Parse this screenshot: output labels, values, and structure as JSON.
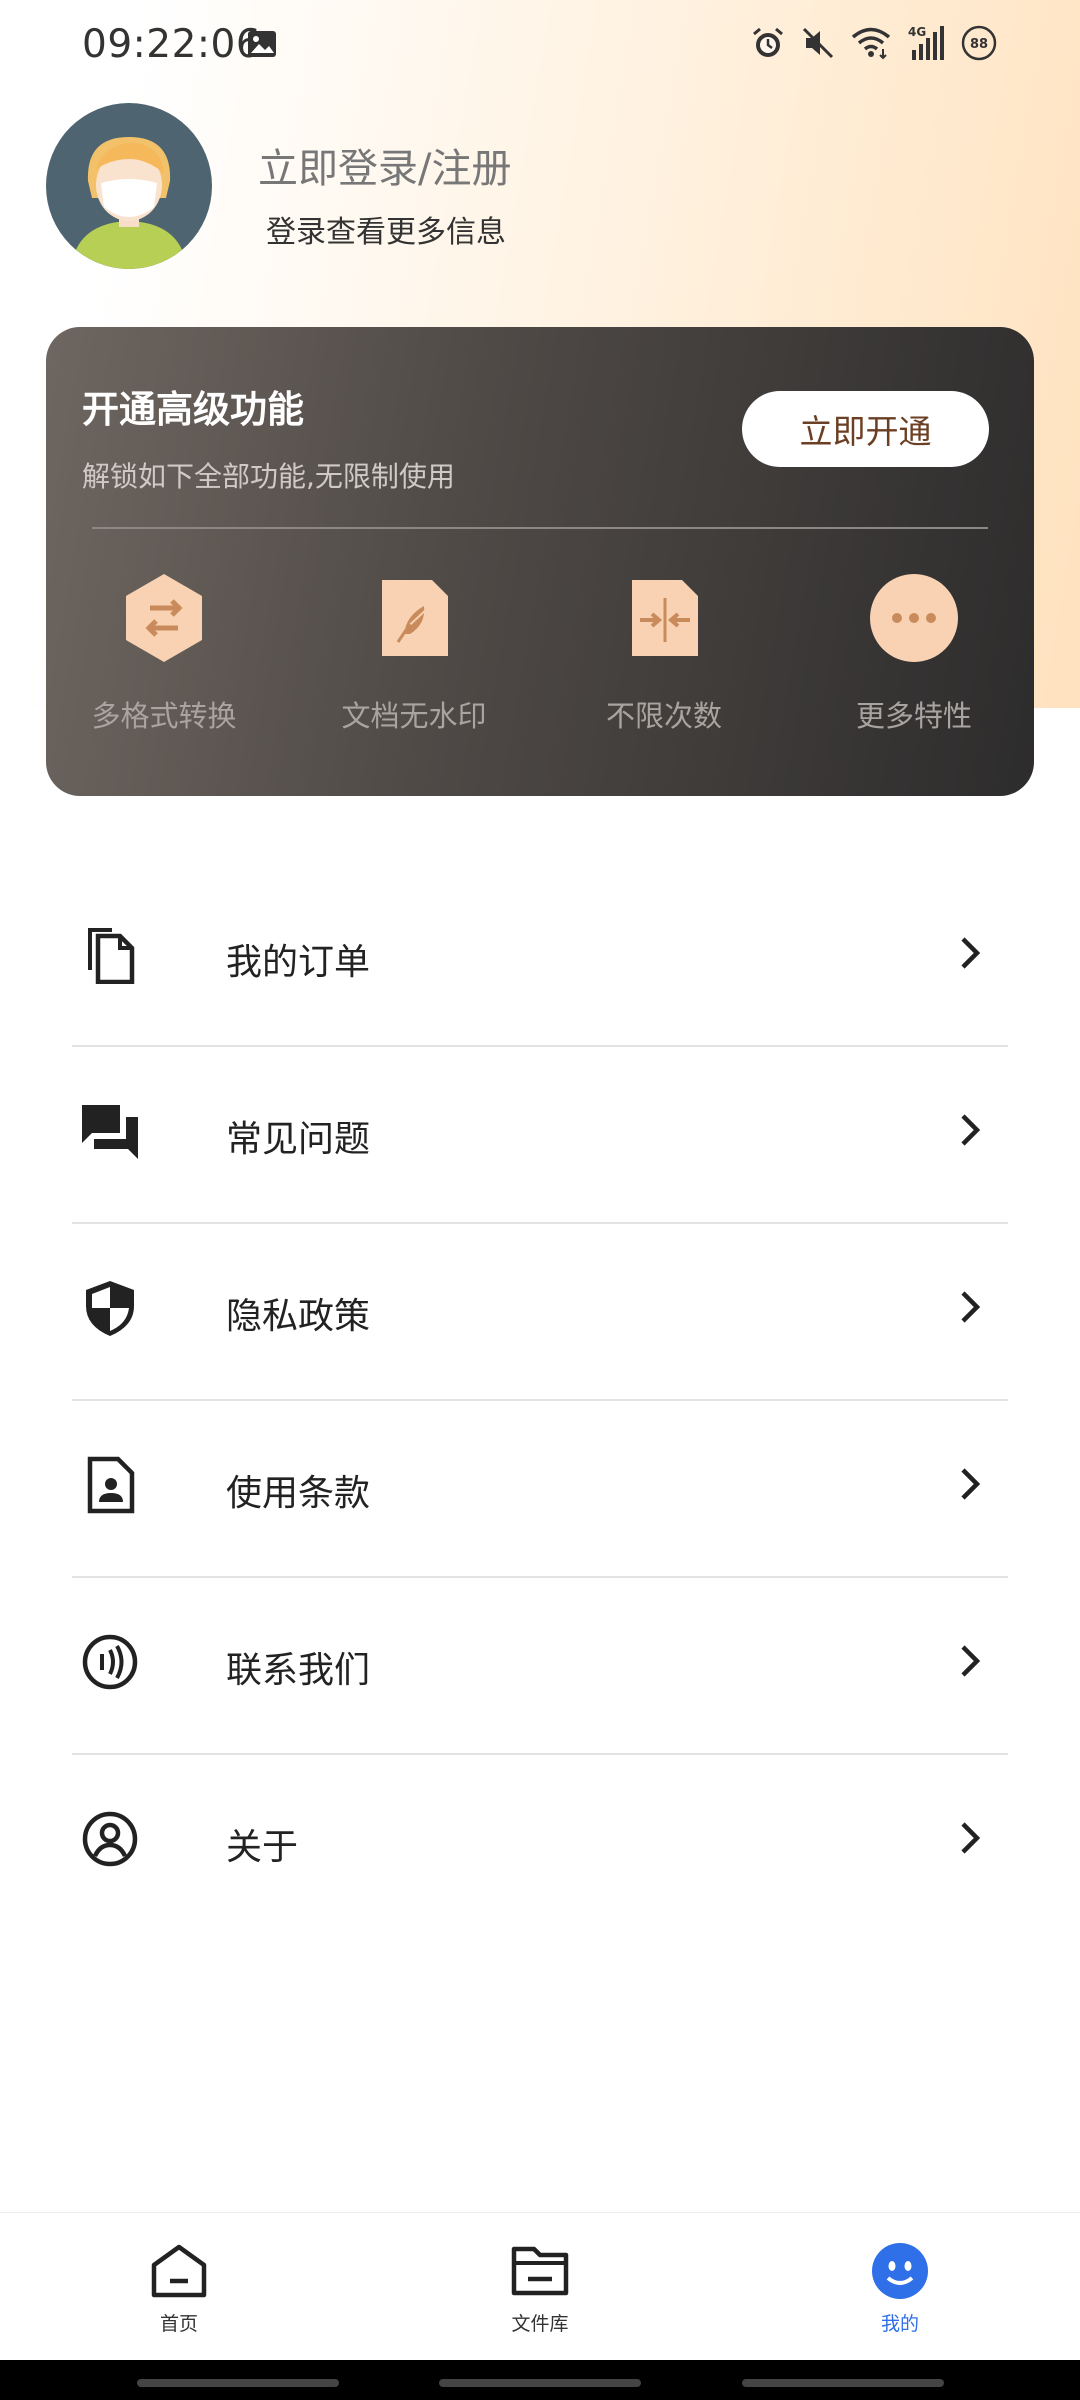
{
  "status_bar": {
    "time": "09:22:06",
    "network": "4G",
    "battery": "88",
    "icons": [
      "gallery-icon",
      "alarm-icon",
      "mute-icon",
      "wifi-icon",
      "signal-icon",
      "battery-icon"
    ]
  },
  "profile": {
    "login_title": "立即登录/注册",
    "login_subtitle": "登录查看更多信息"
  },
  "vip": {
    "title": "开通高级功能",
    "subtitle": "解锁如下全部功能,无限制使用",
    "button_label": "立即开通",
    "features": [
      {
        "label": "多格式转换",
        "icon": "format-convert-icon"
      },
      {
        "label": "文档无水印",
        "icon": "no-watermark-icon"
      },
      {
        "label": "不限次数",
        "icon": "unlimited-icon"
      },
      {
        "label": "更多特性",
        "icon": "more-icon"
      }
    ]
  },
  "menu": [
    {
      "label": "我的订单",
      "icon": "orders-icon"
    },
    {
      "label": "常见问题",
      "icon": "faq-icon"
    },
    {
      "label": "隐私政策",
      "icon": "privacy-shield-icon"
    },
    {
      "label": "使用条款",
      "icon": "terms-icon"
    },
    {
      "label": "联系我们",
      "icon": "contact-icon"
    },
    {
      "label": "关于",
      "icon": "about-icon"
    }
  ],
  "bottom_nav": {
    "items": [
      {
        "label": "首页",
        "icon": "home-icon"
      },
      {
        "label": "文件库",
        "icon": "folder-icon"
      },
      {
        "label": "我的",
        "icon": "profile-face-icon"
      }
    ],
    "active_index": 2
  },
  "colors": {
    "accent": "#2f6fe8",
    "vip_button_text": "#6b3f24",
    "feature_icon": "#f8d2b2"
  }
}
